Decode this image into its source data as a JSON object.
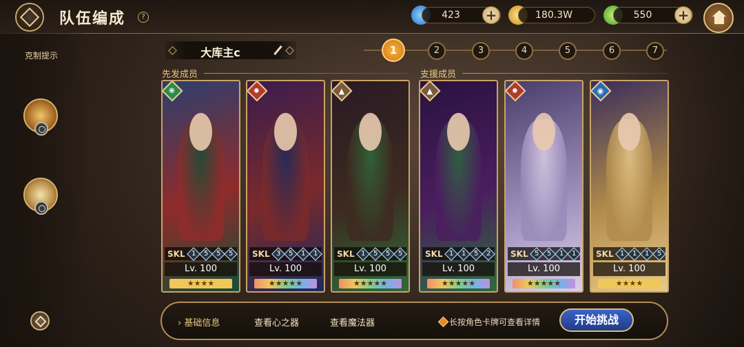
{
  "header": {
    "title": "队伍编成",
    "help": "?",
    "resources": [
      {
        "icon": "water-drop-icon",
        "value": "423"
      },
      {
        "icon": "gold-coin-icon",
        "value": "180.3W"
      },
      {
        "icon": "green-crystal-icon",
        "value": "550"
      }
    ],
    "plus": "+"
  },
  "sidebar": {
    "hint_label": "克制提示"
  },
  "team": {
    "name": "大库主c",
    "pages": [
      "1",
      "2",
      "3",
      "4",
      "5",
      "6",
      "7"
    ],
    "active_page": "1"
  },
  "sections": {
    "main": "先发成员",
    "support": "支援成员"
  },
  "cards": [
    {
      "element": "wind",
      "element_color": "#2f8a4a",
      "skl_label": "SKL",
      "skl": [
        "1",
        "5",
        "5",
        "5"
      ],
      "level": "Lv. 100",
      "stars": "★★★★",
      "star_style": "gold",
      "bg": [
        "#2c3f6e",
        "#8f2b2b",
        "#1a4d36"
      ]
    },
    {
      "element": "fire",
      "element_color": "#b23a2a",
      "skl_label": "SKL",
      "skl": [
        "3",
        "5",
        "1",
        "1"
      ],
      "level": "Lv. 100",
      "stars": "★★★★★",
      "star_style": "rainbow",
      "bg": [
        "#3a1d4d",
        "#7a2a2a",
        "#1d2b5c"
      ]
    },
    {
      "element": "earth",
      "element_color": "#7a5a3a",
      "skl_label": "SKL",
      "skl": [
        "1",
        "5",
        "5",
        "5"
      ],
      "level": "Lv. 100",
      "stars": "★★★★★",
      "star_style": "rainbow",
      "bg": [
        "#2a1a24",
        "#3d2a20",
        "#2f6a3a"
      ]
    },
    {
      "element": "earth",
      "element_color": "#7a5a3a",
      "skl_label": "SKL",
      "skl": [
        "1",
        "1",
        "5",
        "2"
      ],
      "level": "Lv. 100",
      "stars": "★★★★★",
      "star_style": "rainbow",
      "bg": [
        "#2a1240",
        "#4a1e5e",
        "#2e6a3e"
      ]
    },
    {
      "element": "fire",
      "element_color": "#b23a2a",
      "skl_label": "SKL",
      "skl": [
        "5",
        "5",
        "1",
        "1"
      ],
      "level": "Lv. 100",
      "stars": "★★★★★",
      "star_style": "rainbow",
      "bg": [
        "#4a3d6a",
        "#9a8ab8",
        "#d9cfe8"
      ]
    },
    {
      "element": "water",
      "element_color": "#2c6cb0",
      "skl_label": "SKL",
      "skl": [
        "1",
        "1",
        "1",
        "5"
      ],
      "level": "Lv. 100",
      "stars": "★★★★",
      "star_style": "gold",
      "bg": [
        "#3a2e5a",
        "#b08a4a",
        "#e8c98a"
      ]
    }
  ],
  "bottom": {
    "tabs": [
      "基础信息",
      "查看心之器",
      "查看魔法器"
    ],
    "hint": "长按角色卡牌可查看详情",
    "start": "开始挑战"
  }
}
